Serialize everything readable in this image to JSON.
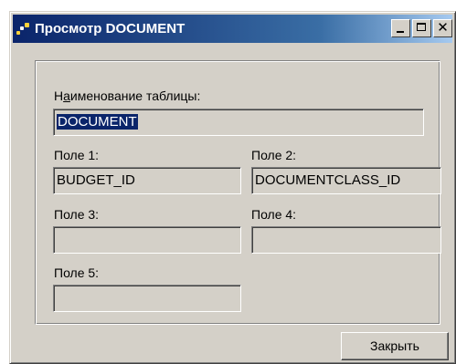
{
  "window": {
    "title": "Просмотр DOCUMENT",
    "buttons": {
      "minimize": "_",
      "maximize": "□",
      "close": "✕"
    }
  },
  "table_name": {
    "label_before": "Н",
    "label_accel": "а",
    "label_after": "именование таблицы:",
    "value": "DOCUMENT"
  },
  "fields": [
    {
      "label": "Поле 1:",
      "value": "BUDGET_ID"
    },
    {
      "label": "Поле 2:",
      "value": "DOCUMENTCLASS_ID"
    },
    {
      "label": "Поле 3:",
      "value": ""
    },
    {
      "label": "Поле 4:",
      "value": ""
    },
    {
      "label": "Поле 5:",
      "value": ""
    }
  ],
  "close_button": {
    "label": "Закрыть"
  },
  "colors": {
    "face": "#d4d0c8",
    "title_start": "#0a246a",
    "title_end": "#a6caf0",
    "selection": "#0a246a"
  }
}
